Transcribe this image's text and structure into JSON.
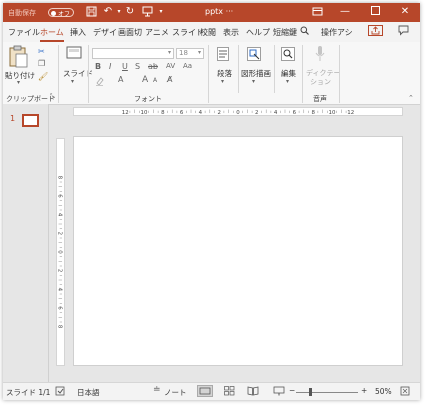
{
  "titlebar": {
    "autosave_label": "自動保存",
    "autosave_state": "オフ",
    "doc_title": "pptx",
    "doc_title_suffix": "···"
  },
  "tabs": [
    "ファイル",
    "ホーム",
    "挿入",
    "デザイ",
    "画面切",
    "アニメ",
    "スライド",
    "校閲",
    "表示",
    "ヘルプ",
    "短縮鍵"
  ],
  "active_tab": "ホーム",
  "tell_me": "操作アシ",
  "ribbon": {
    "clipboard": {
      "paste_label": "貼り付け",
      "group_label": "クリップボード"
    },
    "slides": {
      "new_slide_label": "スライド"
    },
    "font": {
      "font_name_value": "",
      "font_size_value": "18",
      "group_label": "フォント",
      "buttons": [
        "B",
        "I",
        "U",
        "S",
        "ab",
        "AV",
        "Aa",
        "A",
        "A"
      ]
    },
    "paragraph": {
      "label": "段落"
    },
    "drawing": {
      "label": "図形描画"
    },
    "editing": {
      "label": "編集"
    },
    "voice": {
      "dictation_label": "ディクテーション",
      "dictation_line1": "ディクテー",
      "dictation_line2": "ション",
      "group_label": "音声"
    }
  },
  "thumbnails": {
    "slide_number": "1"
  },
  "ruler": {
    "h_labels": [
      "12",
      "10",
      "8",
      "6",
      "4",
      "2",
      "0",
      "2",
      "4",
      "6",
      "8",
      "10",
      "12"
    ],
    "v_labels": [
      "8",
      "6",
      "4",
      "2",
      "0",
      "2",
      "4",
      "6",
      "8"
    ]
  },
  "status": {
    "slide_info": "スライド 1/1",
    "language": "日本語",
    "notes_label": "ノート",
    "zoom_percent": "50%",
    "zoom_level": 50
  },
  "colors": {
    "accent": "#b7472a",
    "chrome": "#f3f3f3",
    "workspace": "#e6e6e6"
  },
  "icons": [
    "save-icon",
    "undo-icon",
    "redo-icon",
    "present-icon",
    "customize-qat-icon",
    "ribbon-display-icon",
    "minimize-icon",
    "maximize-icon",
    "close-icon",
    "search-icon",
    "share-icon",
    "comments-icon",
    "paste-icon",
    "cut-icon",
    "copy-icon",
    "format-painter-icon",
    "new-slide-icon",
    "paragraph-icon",
    "shapes-icon",
    "find-icon",
    "microphone-icon",
    "collapse-ribbon-icon",
    "accessibility-icon",
    "normal-view-icon",
    "slide-sorter-icon",
    "reading-view-icon",
    "slideshow-icon",
    "fit-window-icon"
  ]
}
